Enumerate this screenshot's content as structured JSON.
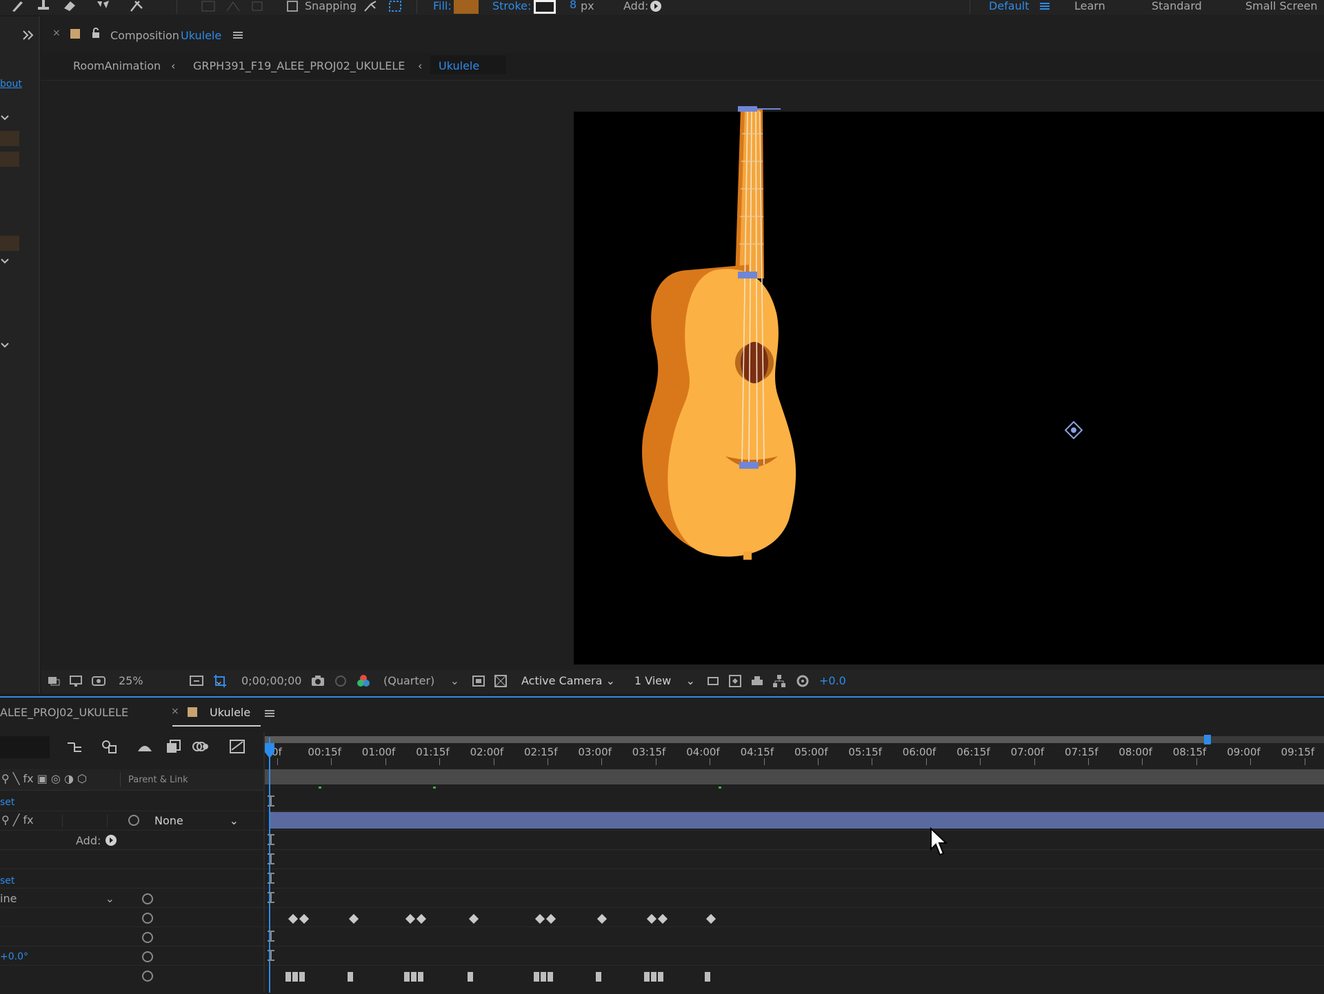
{
  "toolbar": {
    "snapping_label": "Snapping",
    "fill_label": "Fill:",
    "stroke_label": "Stroke:",
    "stroke_width": "8",
    "stroke_unit": "px",
    "add_label": "Add:",
    "fill_color": "#a0621d",
    "accent_color": "#2d8ceb"
  },
  "workspaces": [
    "Default",
    "Learn",
    "Standard",
    "Small Screen"
  ],
  "comp_panel": {
    "title_prefix": "Composition",
    "title_name": "Ukulele",
    "breadcrumbs": [
      "RoomAnimation",
      "GRPH391_F19_ALEE_PROJ02_UKULELE",
      "Ukulele"
    ]
  },
  "left_panel": {
    "about_fragment": "bout"
  },
  "viewer_bar": {
    "zoom": "25%",
    "timecode": "0;00;00;00",
    "resolution": "(Quarter)",
    "camera": "Active Camera",
    "views": "1 View",
    "exposure": "+0.0"
  },
  "timeline": {
    "tab_left": "ALEE_PROJ02_UKULELE",
    "tab_active": "Ukulele",
    "ruler_ticks": [
      "0f",
      "00:15f",
      "01:00f",
      "01:15f",
      "02:00f",
      "02:15f",
      "03:00f",
      "03:15f",
      "04:00f",
      "04:15f",
      "05:00f",
      "05:15f",
      "06:00f",
      "06:15f",
      "07:00f",
      "07:15f",
      "08:00f",
      "08:15f",
      "09:00f",
      "09:15f"
    ],
    "parent_link_header": "Parent & Link",
    "reset_1": "set",
    "parent_value": "None",
    "add_label": "Add:",
    "reset_2": "set",
    "mode_value": "ine",
    "rotation_value": "+0.0°"
  }
}
